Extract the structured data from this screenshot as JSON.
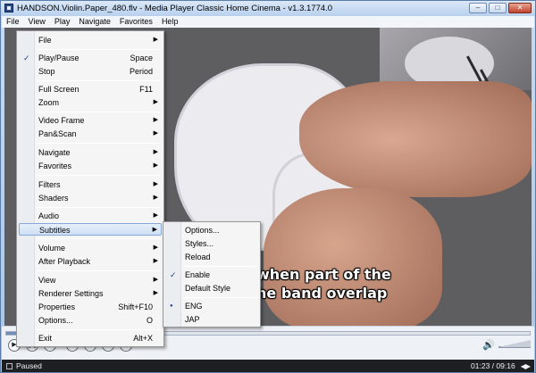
{
  "window": {
    "title": "HANDSON.Violin.Paper_480.flv - Media Player Classic Home Cinema - v1.3.1774.0",
    "minimize_glyph": "–",
    "maximize_glyph": "□",
    "close_glyph": "✕"
  },
  "menubar": {
    "items": [
      "File",
      "View",
      "Play",
      "Navigate",
      "Favorites",
      "Help"
    ]
  },
  "video": {
    "subtitle_line1": "when part of the",
    "subtitle_line2": "he band overlap"
  },
  "context_menu": {
    "items": [
      {
        "label": "File",
        "submenu": true
      },
      {
        "label": "Play/Pause",
        "shortcut": "Space",
        "checked": true
      },
      {
        "label": "Stop",
        "shortcut": "Period"
      },
      {
        "label": "Full Screen",
        "shortcut": "F11"
      },
      {
        "label": "Zoom",
        "submenu": true
      },
      {
        "label": "Video Frame",
        "submenu": true
      },
      {
        "label": "Pan&Scan",
        "submenu": true
      },
      {
        "label": "Navigate",
        "submenu": true
      },
      {
        "label": "Favorites",
        "submenu": true
      },
      {
        "label": "Filters",
        "submenu": true
      },
      {
        "label": "Shaders",
        "submenu": true
      },
      {
        "label": "Audio",
        "submenu": true
      },
      {
        "label": "Subtitles",
        "submenu": true,
        "highlighted": true
      },
      {
        "label": "Volume",
        "submenu": true
      },
      {
        "label": "After Playback",
        "submenu": true
      },
      {
        "label": "View",
        "submenu": true
      },
      {
        "label": "Renderer Settings",
        "submenu": true
      },
      {
        "label": "Properties",
        "shortcut": "Shift+F10"
      },
      {
        "label": "Options...",
        "shortcut": "O"
      },
      {
        "label": "Exit",
        "shortcut": "Alt+X"
      }
    ],
    "submenu_arrow": "▶",
    "check_glyph": "✓"
  },
  "subtitles_menu": {
    "items": [
      {
        "label": "Options..."
      },
      {
        "label": "Styles..."
      },
      {
        "label": "Reload"
      },
      {
        "label": "Enable",
        "checked": true
      },
      {
        "label": "Default Style"
      },
      {
        "label": "ENG",
        "radio": true
      },
      {
        "label": "JAP"
      }
    ],
    "radio_glyph": "●"
  },
  "controls": {
    "seek_progress": 0.146,
    "play_glyph": "▶",
    "pause_glyph": "❚❚",
    "stop_glyph": "■",
    "prev_glyph": "◀◀",
    "back_glyph": "◀",
    "fwd_glyph": "▶",
    "next_glyph": "▶▶",
    "volume_glyph": "🔊"
  },
  "status": {
    "state": "Paused",
    "time": "01:23 / 09:16",
    "arrows": "◀▶"
  }
}
